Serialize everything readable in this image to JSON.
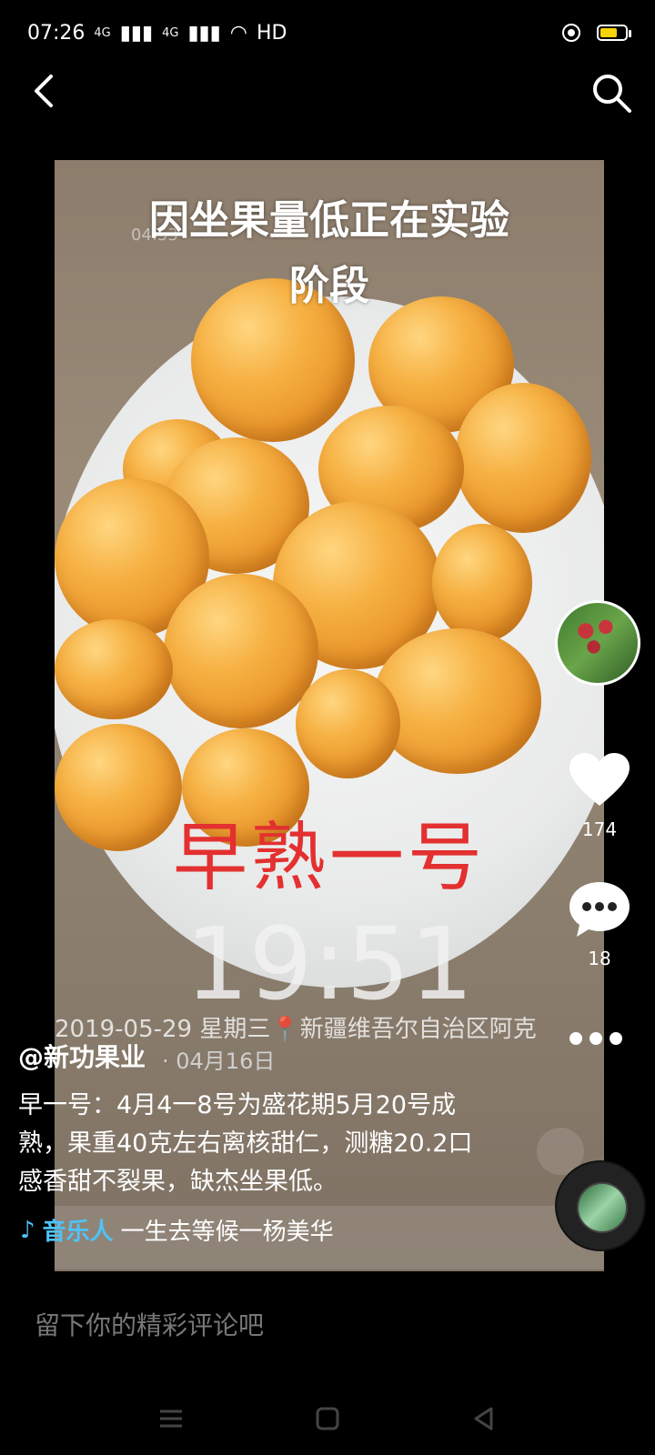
{
  "status_bar": {
    "time": "07:26",
    "network_1": "4G",
    "network_2": "4G",
    "hd_label": "HD"
  },
  "video": {
    "embedded_time": "04:53",
    "caption_line1": "因坐果量低正在实验",
    "caption_line2": "阶段",
    "overlay_title": "早熟一号",
    "overlay_time": "19:51",
    "overlay_date": "2019-05-29 星期三📍新疆维吾尔自治区阿克"
  },
  "rail": {
    "likes": "174",
    "comments": "18"
  },
  "post": {
    "author": "@新功果业",
    "date": "· 04月16日",
    "description": "早一号：4月4一8号为盛花期5月20号成熟，果重40克左右离核甜仁，测糖20.2口感香甜不裂果，缺杰坐果低。",
    "music_tag": "音乐人",
    "music_title": "一生去等候一杨美华"
  },
  "comment_bar": {
    "placeholder": "留下你的精彩评论吧"
  },
  "colors": {
    "music_accent": "#4fc3f7",
    "battery": "#f5d400",
    "overlay_red": "#e33030"
  }
}
